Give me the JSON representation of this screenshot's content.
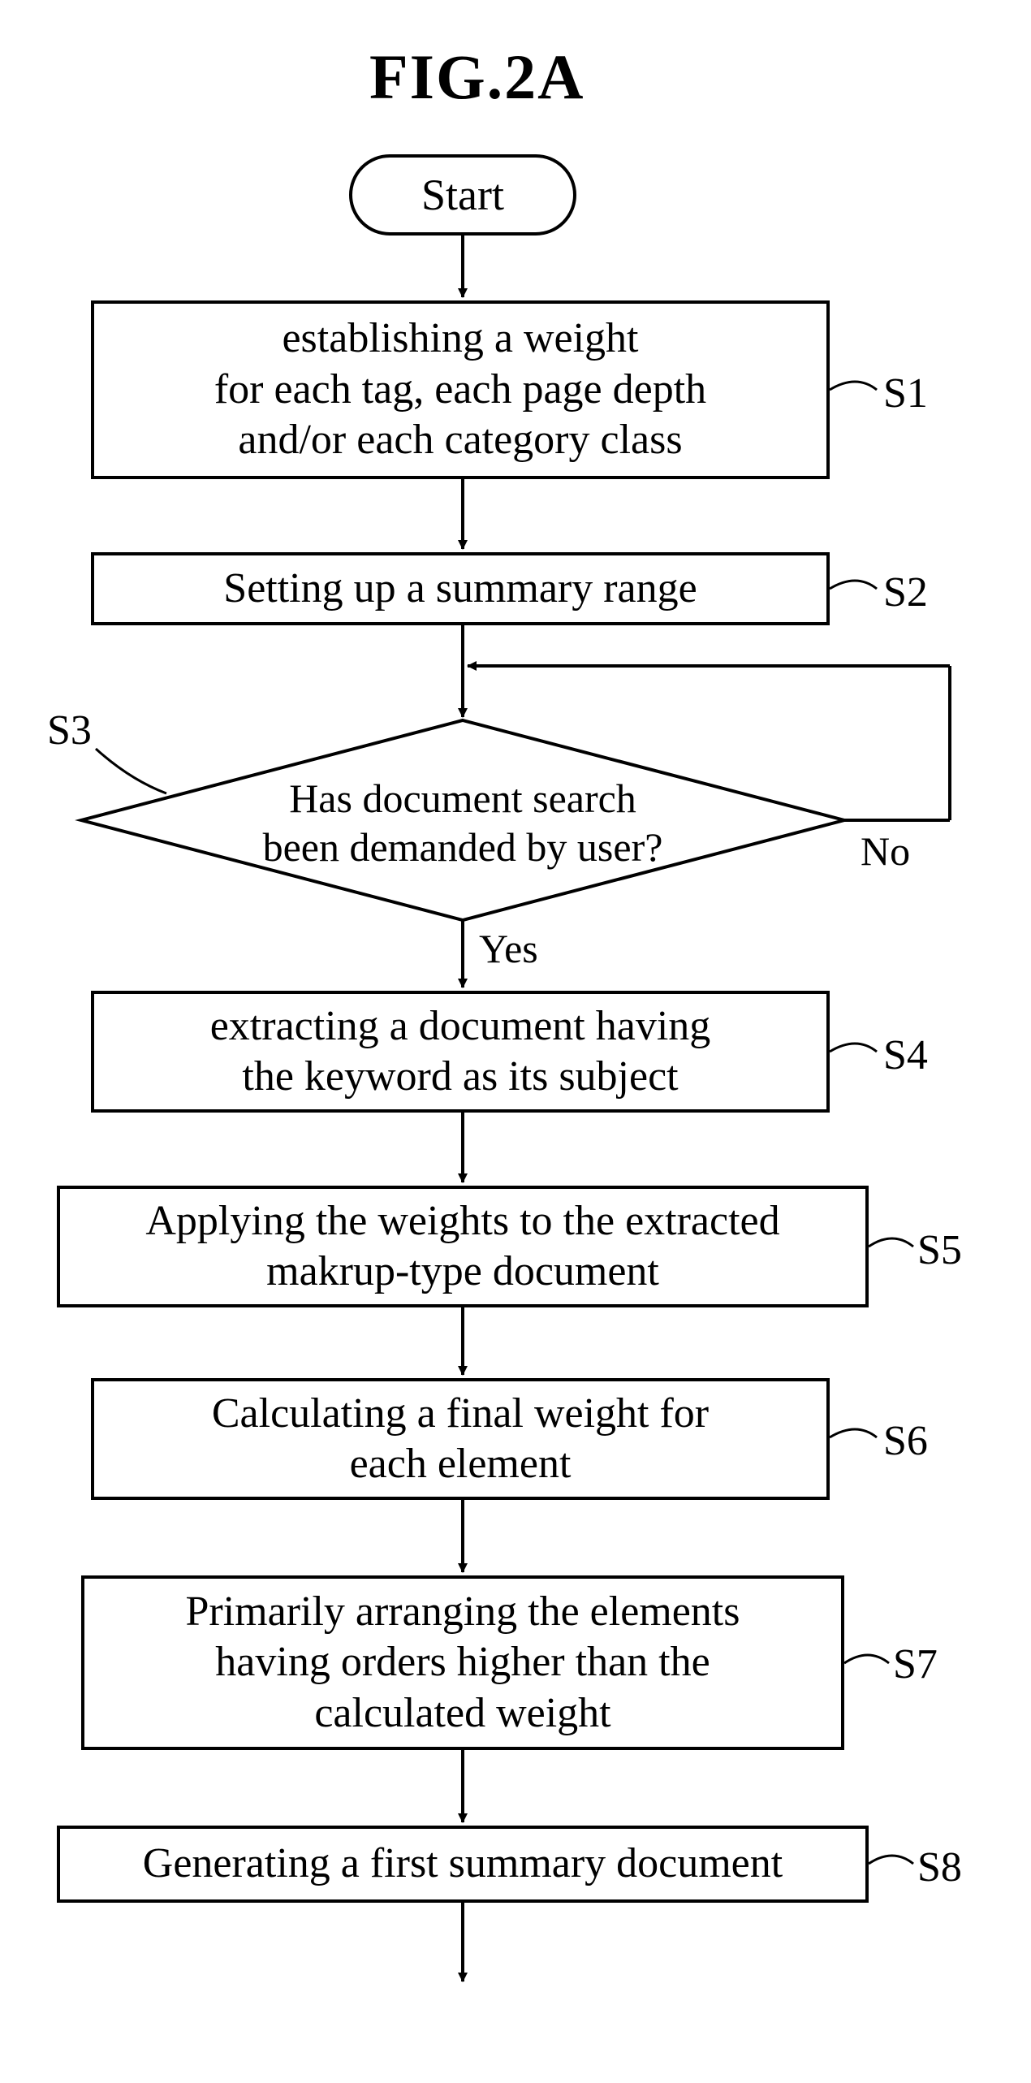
{
  "title": "FIG.2A",
  "start": "Start",
  "steps": {
    "s1": {
      "text": "establishing a weight\nfor each tag, each page depth\nand/or each category class",
      "label": "S1"
    },
    "s2": {
      "text": "Setting up a summary range",
      "label": "S2"
    },
    "s3": {
      "text": "Has document search\nbeen demanded by user?",
      "label": "S3",
      "yes": "Yes",
      "no": "No"
    },
    "s4": {
      "text": "extracting a document having\nthe keyword as its subject",
      "label": "S4"
    },
    "s5": {
      "text": "Applying the weights to the extracted\nmakrup-type document",
      "label": "S5"
    },
    "s6": {
      "text": "Calculating a final weight for\neach element",
      "label": "S6"
    },
    "s7": {
      "text": "Primarily arranging the elements\nhaving orders higher than the\ncalculated weight",
      "label": "S7"
    },
    "s8": {
      "text": "Generating a first summary document",
      "label": "S8"
    }
  }
}
